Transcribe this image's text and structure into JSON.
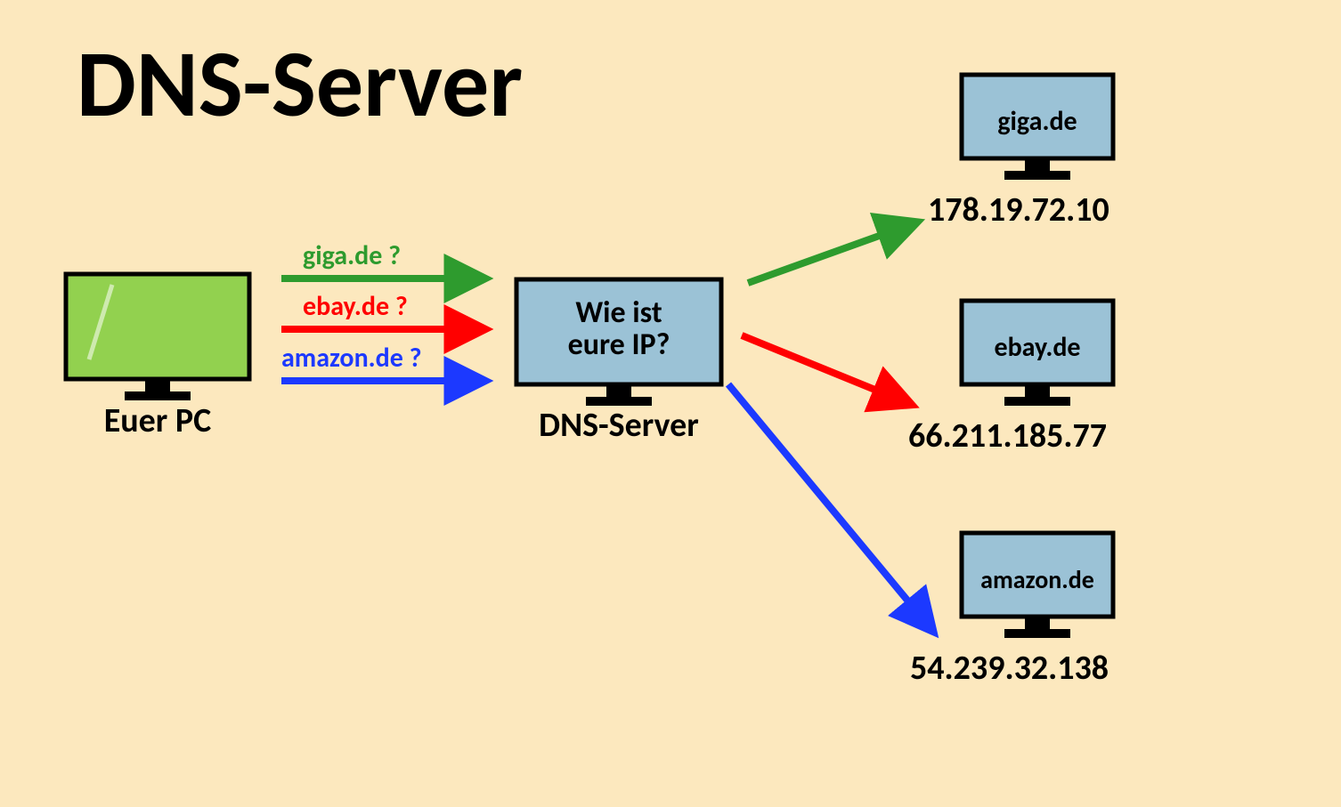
{
  "title": "DNS-Server",
  "pc": {
    "label": "Euer PC"
  },
  "dns": {
    "label": "DNS-Server",
    "screen_line1": "Wie ist",
    "screen_line2": "eure IP?"
  },
  "queries": {
    "giga": {
      "text": "giga.de ?",
      "color": "#2e9b2e"
    },
    "ebay": {
      "text": "ebay.de ?",
      "color": "#ff0000"
    },
    "amazon": {
      "text": "amazon.de ?",
      "color": "#1c39ff"
    }
  },
  "servers": {
    "giga": {
      "domain": "giga.de",
      "ip": "178.19.72.10"
    },
    "ebay": {
      "domain": "ebay.de",
      "ip": "66.211.185.77"
    },
    "amazon": {
      "domain": "amazon.de",
      "ip": "54.239.32.138"
    }
  },
  "colors": {
    "bg": "#fce8be",
    "pc_fill": "#92d14f",
    "server_fill": "#9bc2d6",
    "green": "#2e9b2e",
    "red": "#ff0000",
    "blue": "#1c39ff"
  }
}
